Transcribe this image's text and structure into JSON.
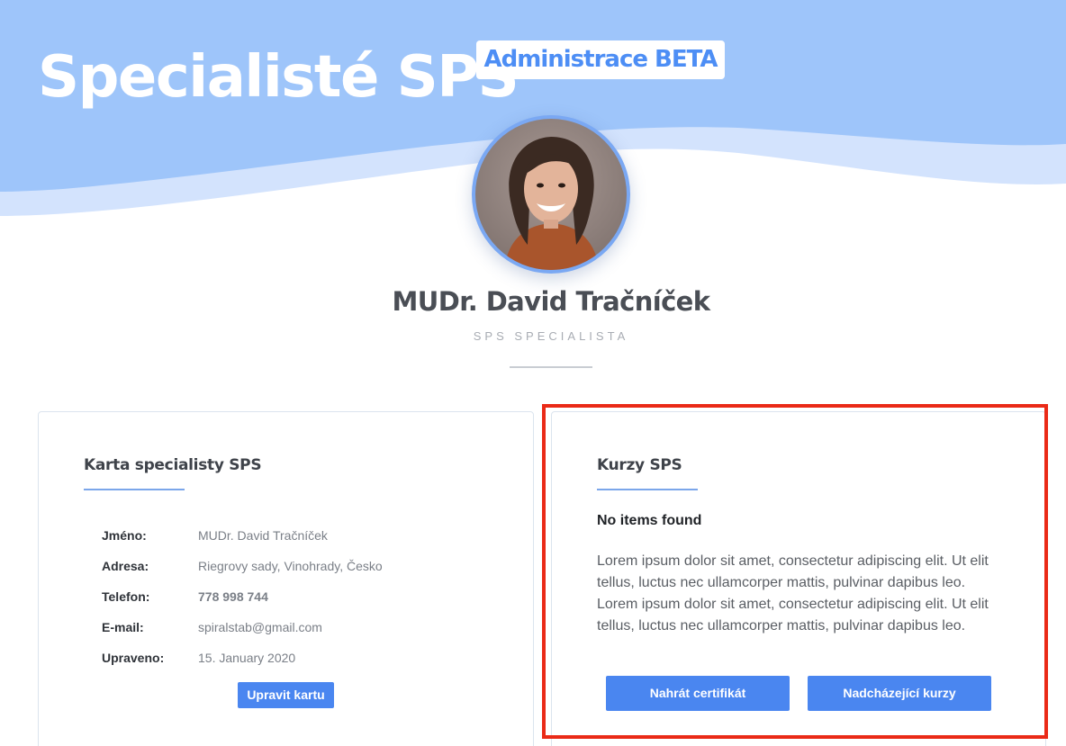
{
  "header": {
    "site_title": "Specialisté SPS",
    "badge": "Administrace BETA"
  },
  "profile": {
    "name": "MUDr. David Tračníček",
    "role": "SPS SPECIALISTA",
    "avatar_icon": "person-photo"
  },
  "specialist_card": {
    "title": "Karta specialisty SPS",
    "rows": [
      {
        "label": "Jméno:",
        "value": "MUDr. David Tračníček"
      },
      {
        "label": "Adresa:",
        "value": "Riegrovy sady, Vinohrady, Česko"
      },
      {
        "label": "Telefon:",
        "value": "778 998 744"
      },
      {
        "label": "E-mail:",
        "value": "spiralstab@gmail.com"
      },
      {
        "label": "Upraveno:",
        "value": "15. January 2020"
      }
    ],
    "edit_button": "Upravit kartu"
  },
  "courses_card": {
    "title": "Kurzy SPS",
    "empty_title": "No items found",
    "description": "Lorem ipsum dolor sit amet, consectetur adipiscing elit. Ut elit tellus, luctus nec ullamcorper mattis, pulvinar dapibus leo. Lorem ipsum dolor sit amet, consectetur adipiscing elit. Ut elit tellus, luctus nec ullamcorper mattis, pulvinar dapibus leo.",
    "upload_button": "Nahrát certifikát",
    "upcoming_button": "Nadcházející kurzy"
  },
  "colors": {
    "hero_blue": "#9cc4fa",
    "accent": "#4a86f0",
    "badge_text": "#4d8ef5",
    "highlight_red": "#ea2a17"
  }
}
